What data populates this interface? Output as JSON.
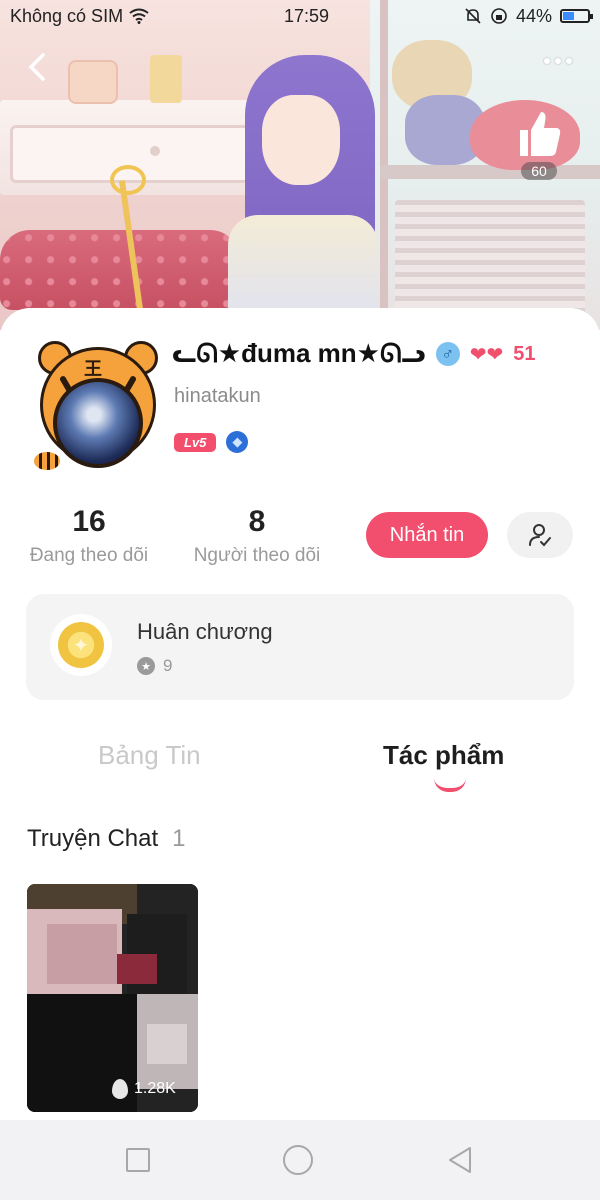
{
  "status_bar": {
    "carrier": "Không có SIM",
    "time": "17:59",
    "battery_percent": "44%",
    "battery_level": 0.44,
    "icons": [
      "wifi-icon",
      "bell-off-icon",
      "orientation-lock-icon",
      "battery-icon"
    ]
  },
  "header": {
    "back_icon": "chevron-left-icon",
    "more_icon": "more-dots-icon",
    "like_icon": "thumbs-up-icon",
    "like_count": "60"
  },
  "profile": {
    "display_name": "ᓚᘏ★đuma mn★ᘏᓗ",
    "gender_icon": "male-icon",
    "hearts_icon": "hearts-icon",
    "heart_count": "51",
    "username": "hinatakun",
    "level_badge": "Lv5",
    "badge_icon": "diamond-badge-icon"
  },
  "stats": {
    "following_count": "16",
    "following_label": "Đang theo dõi",
    "followers_count": "8",
    "followers_label": "Người theo dõi"
  },
  "actions": {
    "message_label": "Nhắn tin",
    "follow_icon": "user-check-icon"
  },
  "medals": {
    "title": "Huân chương",
    "count": "9"
  },
  "tabs": {
    "feed_label": "Bảng Tin",
    "works_label": "Tác phẩm",
    "active": "works"
  },
  "section": {
    "title": "Truyện Chat",
    "count": "1"
  },
  "stories": [
    {
      "views": "1.28K"
    }
  ],
  "colors": {
    "accent": "#f24e6e",
    "muted_text": "#9a9a9a",
    "card_bg": "#f4f4f4"
  }
}
